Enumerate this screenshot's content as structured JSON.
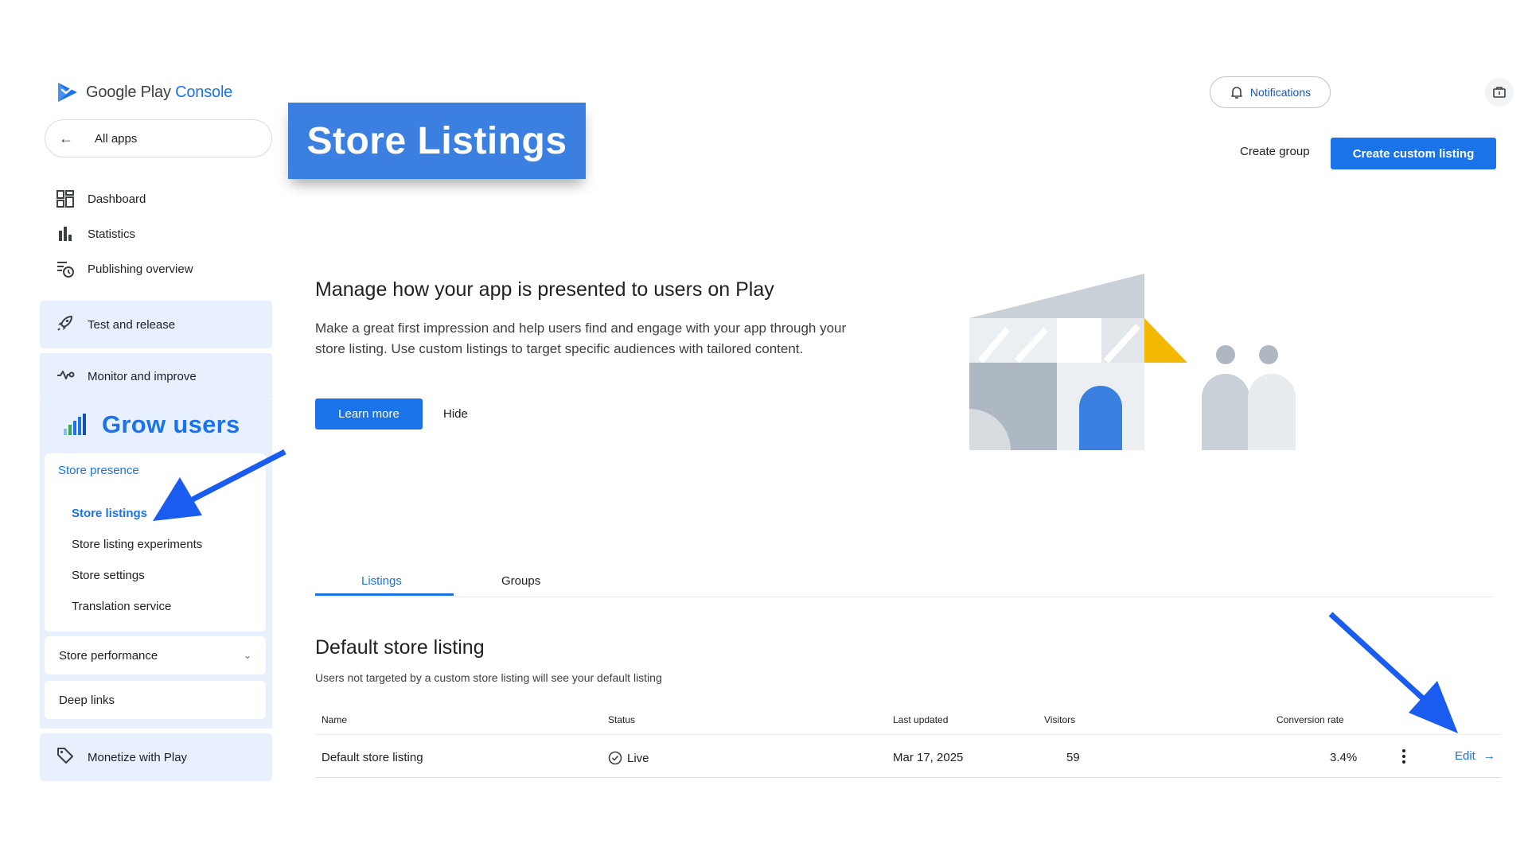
{
  "brand": {
    "logo_word": "Google Play",
    "logo_console": "Console"
  },
  "sidebar": {
    "all_apps": "All apps",
    "items": [
      {
        "label": "Dashboard",
        "icon": "dashboard-icon"
      },
      {
        "label": "Statistics",
        "icon": "bar-chart-icon"
      },
      {
        "label": "Publishing overview",
        "icon": "publishing-clock-icon"
      }
    ],
    "test_release": "Test and release",
    "monitor_improve": "Monitor and improve",
    "grow_users": "Grow users",
    "store_presence": {
      "label": "Store presence",
      "items": [
        "Store listings",
        "Store listing experiments",
        "Store settings",
        "Translation service"
      ],
      "active_index": 0
    },
    "store_performance": "Store performance",
    "deep_links": "Deep links",
    "monetize": "Monetize with Play"
  },
  "header": {
    "banner": "Store Listings",
    "notifications": "Notifications",
    "create_group": "Create group",
    "create_custom_listing": "Create custom listing"
  },
  "hero": {
    "title": "Manage how your app is presented to users on Play",
    "description": "Make a great first impression and help users find and engage with your app through your store listing. Use custom listings to target specific audiences with tailored content.",
    "learn_more": "Learn more",
    "hide": "Hide"
  },
  "tabs": {
    "listings": "Listings",
    "groups": "Groups",
    "active": "Listings"
  },
  "default_listing": {
    "title": "Default store listing",
    "subtitle": "Users not targeted by a custom store listing will see your default listing",
    "columns": {
      "name": "Name",
      "status": "Status",
      "last_updated": "Last updated",
      "visitors": "Visitors",
      "conversion_rate": "Conversion rate"
    },
    "row": {
      "name": "Default store listing",
      "status": "Live",
      "last_updated": "Mar 17, 2025",
      "visitors": "59",
      "conversion_rate": "3.4%",
      "edit": "Edit"
    }
  },
  "colors": {
    "accent": "#1a73e8",
    "banner": "#3b7fe0",
    "section_bg": "#e8f0fe",
    "annotation_arrow": "#1a5cf0"
  }
}
